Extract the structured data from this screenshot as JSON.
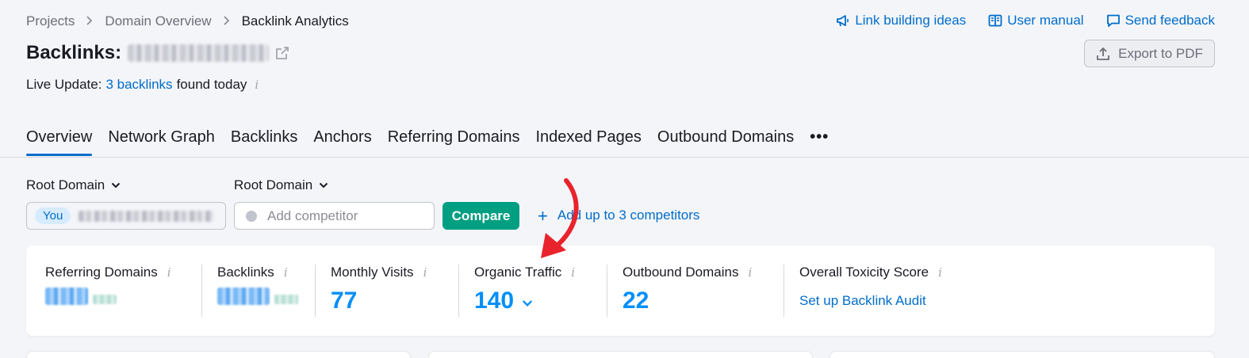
{
  "breadcrumb": {
    "items": [
      "Projects",
      "Domain Overview",
      "Backlink Analytics"
    ],
    "separator": ">"
  },
  "top_links": {
    "link_building": "Link building ideas",
    "user_manual": "User manual",
    "send_feedback": "Send feedback"
  },
  "header": {
    "title_prefix": "Backlinks:",
    "export_label": "Export to PDF"
  },
  "live_update": {
    "prefix": "Live Update:",
    "link": "3 backlinks",
    "suffix": "found today",
    "info": "i"
  },
  "tabs": [
    {
      "label": "Overview",
      "active": true
    },
    {
      "label": "Network Graph"
    },
    {
      "label": "Backlinks"
    },
    {
      "label": "Anchors"
    },
    {
      "label": "Referring Domains"
    },
    {
      "label": "Indexed Pages"
    },
    {
      "label": "Outbound Domains"
    }
  ],
  "tabs_more": "•••",
  "filters": {
    "you": {
      "scope": "Root Domain",
      "badge": "You"
    },
    "competitor": {
      "scope": "Root Domain",
      "placeholder": "Add competitor"
    },
    "compare_label": "Compare",
    "add_link": {
      "plus": "+",
      "label": "Add up to 3 competitors"
    }
  },
  "metrics": {
    "referring_domains": {
      "label": "Referring Domains",
      "info": "i"
    },
    "backlinks": {
      "label": "Backlinks",
      "info": "i"
    },
    "monthly_visits": {
      "label": "Monthly Visits",
      "info": "i",
      "value": "77"
    },
    "organic_traffic": {
      "label": "Organic Traffic",
      "info": "i",
      "value": "140"
    },
    "outbound_domains": {
      "label": "Outbound Domains",
      "info": "i",
      "value": "22"
    },
    "toxicity": {
      "label": "Overall Toxicity Score",
      "info": "i",
      "link": "Set up Backlink Audit"
    }
  },
  "colors": {
    "link": "#006dca",
    "metric_value": "#008ff8",
    "compare_button": "#009f81",
    "annotation_arrow": "#e8232b"
  }
}
